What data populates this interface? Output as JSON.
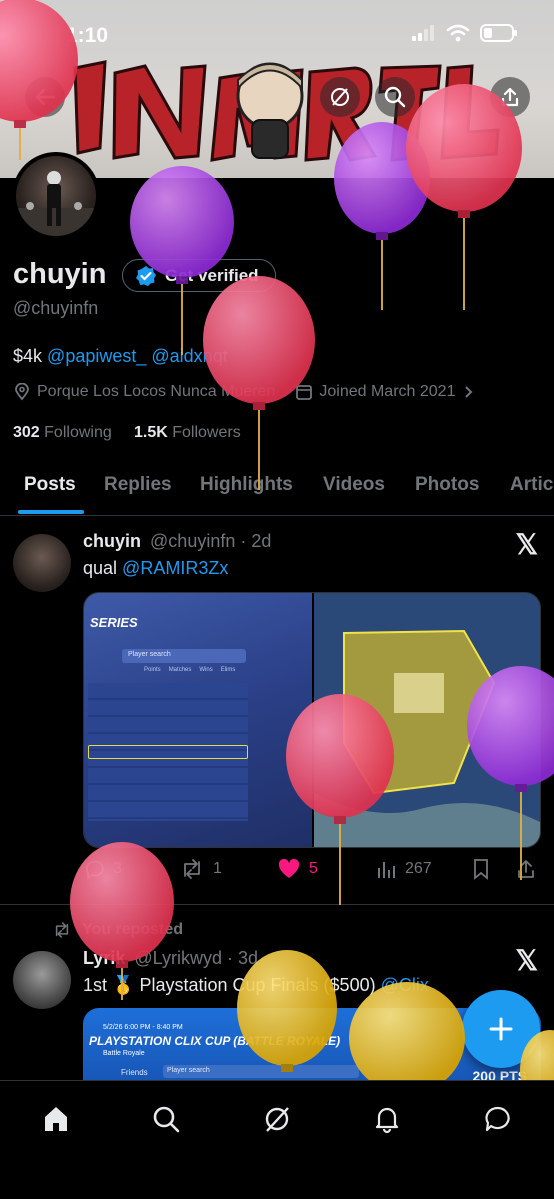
{
  "status": {
    "time": "1:10"
  },
  "banner": {
    "logo_text": "INMORTAL"
  },
  "profile": {
    "name": "chuyin",
    "verify_label": "Get verified",
    "handle": "@chuyinfn",
    "bio_prefix": "$4k",
    "bio_mention_1": "@papiwest_",
    "bio_mention_2": "@aidxnqt",
    "location": "Porque Los Locos Nunca Mueren",
    "joined": "Joined March 2021",
    "following_count": "302",
    "following_label": "Following",
    "followers_count": "1.5K",
    "followers_label": "Followers"
  },
  "tabs": [
    {
      "label": "Posts"
    },
    {
      "label": "Replies"
    },
    {
      "label": "Highlights"
    },
    {
      "label": "Videos"
    },
    {
      "label": "Photos"
    },
    {
      "label": "Artic"
    }
  ],
  "post1": {
    "name": "chuyin",
    "handle": "@chuyinfn",
    "time": "· 2d",
    "text_prefix": "qual",
    "mention": "@RAMIR3Zx",
    "media_left_title": "SERIES",
    "media_left_search": "Player search",
    "media_left_cols": [
      "Points",
      "Matches",
      "Wins",
      "Elims"
    ],
    "replies": "3",
    "reposts": "1",
    "likes": "5",
    "views": "267"
  },
  "post2": {
    "repost_label": "You reposted",
    "name": "Lyrik",
    "handle": "@Lyrikwyd",
    "time": "· 3d",
    "text_prefix": "1st",
    "text_main": "Playstation Cup Finals ($500)",
    "mention": "@Clix",
    "media_date": "5/2/26 6:00 PM - 8:40 PM",
    "media_title": "PLAYSTATION CLIX CUP (BATTLE ROYALE)",
    "media_sub": "Battle Royale",
    "media_friends": "Friends",
    "media_search": "Player search",
    "media_pts": "200 PTS"
  },
  "colors": {
    "accent": "#1d9bf0",
    "like": "#f91880",
    "muted": "#71767b"
  },
  "icons": [
    "back-arrow-icon",
    "grok-icon",
    "search-icon",
    "share-icon",
    "verified-badge-icon",
    "location-icon",
    "calendar-icon",
    "x-logo-icon",
    "reply-icon",
    "repost-icon",
    "heart-icon",
    "views-icon",
    "bookmark-icon",
    "home-icon",
    "compose-plus-icon",
    "bell-icon",
    "messages-icon"
  ]
}
